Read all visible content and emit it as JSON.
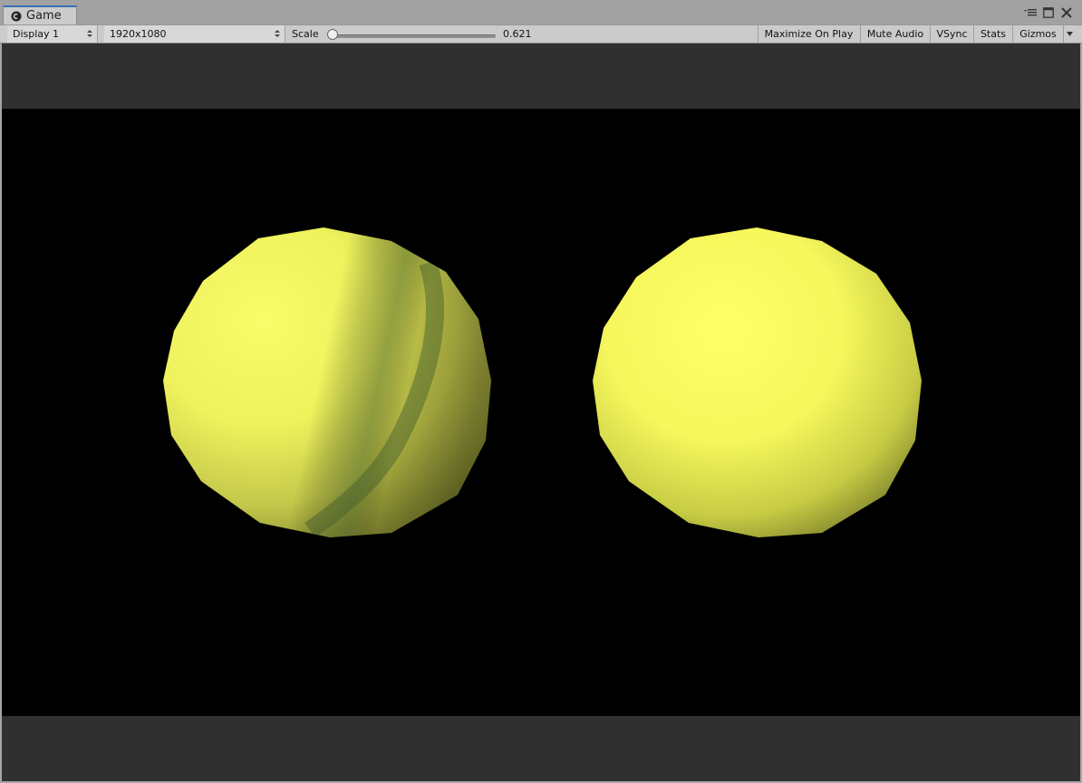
{
  "window": {
    "tab_title": "Game",
    "tab_icon": "unity-logo-icon",
    "controls": [
      "menu-icon",
      "maximize-icon",
      "close-icon"
    ]
  },
  "toolbar": {
    "display_select": "Display 1",
    "resolution_select": "1920x1080",
    "scale_label": "Scale",
    "scale_value": "0.621",
    "scale_fraction": 0.0,
    "buttons": {
      "maximize_on_play": "Maximize On Play",
      "mute_audio": "Mute Audio",
      "vsync": "VSync",
      "stats": "Stats",
      "gizmos": "Gizmos"
    }
  },
  "scene": {
    "background_color": "#000000",
    "sphere_color": "#f2f55a",
    "spheres": [
      "left-sphere",
      "right-sphere"
    ]
  }
}
